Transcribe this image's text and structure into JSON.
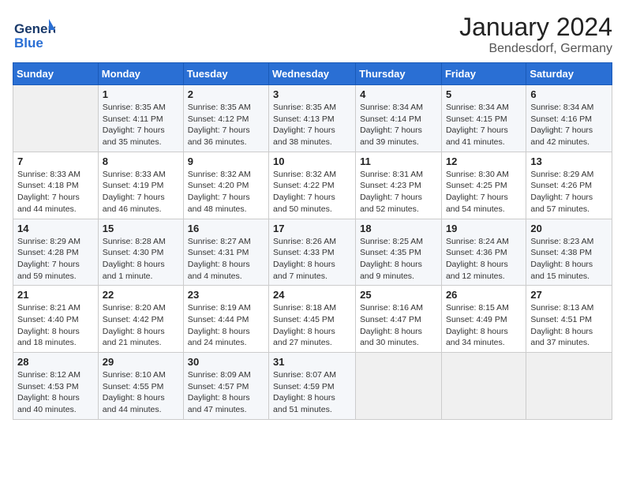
{
  "logo": {
    "text_general": "General",
    "text_blue": "Blue"
  },
  "title": "January 2024",
  "subtitle": "Bendesdorf, Germany",
  "days_of_week": [
    "Sunday",
    "Monday",
    "Tuesday",
    "Wednesday",
    "Thursday",
    "Friday",
    "Saturday"
  ],
  "weeks": [
    [
      {
        "day": "",
        "info": ""
      },
      {
        "day": "1",
        "info": "Sunrise: 8:35 AM\nSunset: 4:11 PM\nDaylight: 7 hours\nand 35 minutes."
      },
      {
        "day": "2",
        "info": "Sunrise: 8:35 AM\nSunset: 4:12 PM\nDaylight: 7 hours\nand 36 minutes."
      },
      {
        "day": "3",
        "info": "Sunrise: 8:35 AM\nSunset: 4:13 PM\nDaylight: 7 hours\nand 38 minutes."
      },
      {
        "day": "4",
        "info": "Sunrise: 8:34 AM\nSunset: 4:14 PM\nDaylight: 7 hours\nand 39 minutes."
      },
      {
        "day": "5",
        "info": "Sunrise: 8:34 AM\nSunset: 4:15 PM\nDaylight: 7 hours\nand 41 minutes."
      },
      {
        "day": "6",
        "info": "Sunrise: 8:34 AM\nSunset: 4:16 PM\nDaylight: 7 hours\nand 42 minutes."
      }
    ],
    [
      {
        "day": "7",
        "info": "Sunrise: 8:33 AM\nSunset: 4:18 PM\nDaylight: 7 hours\nand 44 minutes."
      },
      {
        "day": "8",
        "info": "Sunrise: 8:33 AM\nSunset: 4:19 PM\nDaylight: 7 hours\nand 46 minutes."
      },
      {
        "day": "9",
        "info": "Sunrise: 8:32 AM\nSunset: 4:20 PM\nDaylight: 7 hours\nand 48 minutes."
      },
      {
        "day": "10",
        "info": "Sunrise: 8:32 AM\nSunset: 4:22 PM\nDaylight: 7 hours\nand 50 minutes."
      },
      {
        "day": "11",
        "info": "Sunrise: 8:31 AM\nSunset: 4:23 PM\nDaylight: 7 hours\nand 52 minutes."
      },
      {
        "day": "12",
        "info": "Sunrise: 8:30 AM\nSunset: 4:25 PM\nDaylight: 7 hours\nand 54 minutes."
      },
      {
        "day": "13",
        "info": "Sunrise: 8:29 AM\nSunset: 4:26 PM\nDaylight: 7 hours\nand 57 minutes."
      }
    ],
    [
      {
        "day": "14",
        "info": "Sunrise: 8:29 AM\nSunset: 4:28 PM\nDaylight: 7 hours\nand 59 minutes."
      },
      {
        "day": "15",
        "info": "Sunrise: 8:28 AM\nSunset: 4:30 PM\nDaylight: 8 hours\nand 1 minute."
      },
      {
        "day": "16",
        "info": "Sunrise: 8:27 AM\nSunset: 4:31 PM\nDaylight: 8 hours\nand 4 minutes."
      },
      {
        "day": "17",
        "info": "Sunrise: 8:26 AM\nSunset: 4:33 PM\nDaylight: 8 hours\nand 7 minutes."
      },
      {
        "day": "18",
        "info": "Sunrise: 8:25 AM\nSunset: 4:35 PM\nDaylight: 8 hours\nand 9 minutes."
      },
      {
        "day": "19",
        "info": "Sunrise: 8:24 AM\nSunset: 4:36 PM\nDaylight: 8 hours\nand 12 minutes."
      },
      {
        "day": "20",
        "info": "Sunrise: 8:23 AM\nSunset: 4:38 PM\nDaylight: 8 hours\nand 15 minutes."
      }
    ],
    [
      {
        "day": "21",
        "info": "Sunrise: 8:21 AM\nSunset: 4:40 PM\nDaylight: 8 hours\nand 18 minutes."
      },
      {
        "day": "22",
        "info": "Sunrise: 8:20 AM\nSunset: 4:42 PM\nDaylight: 8 hours\nand 21 minutes."
      },
      {
        "day": "23",
        "info": "Sunrise: 8:19 AM\nSunset: 4:44 PM\nDaylight: 8 hours\nand 24 minutes."
      },
      {
        "day": "24",
        "info": "Sunrise: 8:18 AM\nSunset: 4:45 PM\nDaylight: 8 hours\nand 27 minutes."
      },
      {
        "day": "25",
        "info": "Sunrise: 8:16 AM\nSunset: 4:47 PM\nDaylight: 8 hours\nand 30 minutes."
      },
      {
        "day": "26",
        "info": "Sunrise: 8:15 AM\nSunset: 4:49 PM\nDaylight: 8 hours\nand 34 minutes."
      },
      {
        "day": "27",
        "info": "Sunrise: 8:13 AM\nSunset: 4:51 PM\nDaylight: 8 hours\nand 37 minutes."
      }
    ],
    [
      {
        "day": "28",
        "info": "Sunrise: 8:12 AM\nSunset: 4:53 PM\nDaylight: 8 hours\nand 40 minutes."
      },
      {
        "day": "29",
        "info": "Sunrise: 8:10 AM\nSunset: 4:55 PM\nDaylight: 8 hours\nand 44 minutes."
      },
      {
        "day": "30",
        "info": "Sunrise: 8:09 AM\nSunset: 4:57 PM\nDaylight: 8 hours\nand 47 minutes."
      },
      {
        "day": "31",
        "info": "Sunrise: 8:07 AM\nSunset: 4:59 PM\nDaylight: 8 hours\nand 51 minutes."
      },
      {
        "day": "",
        "info": ""
      },
      {
        "day": "",
        "info": ""
      },
      {
        "day": "",
        "info": ""
      }
    ]
  ]
}
